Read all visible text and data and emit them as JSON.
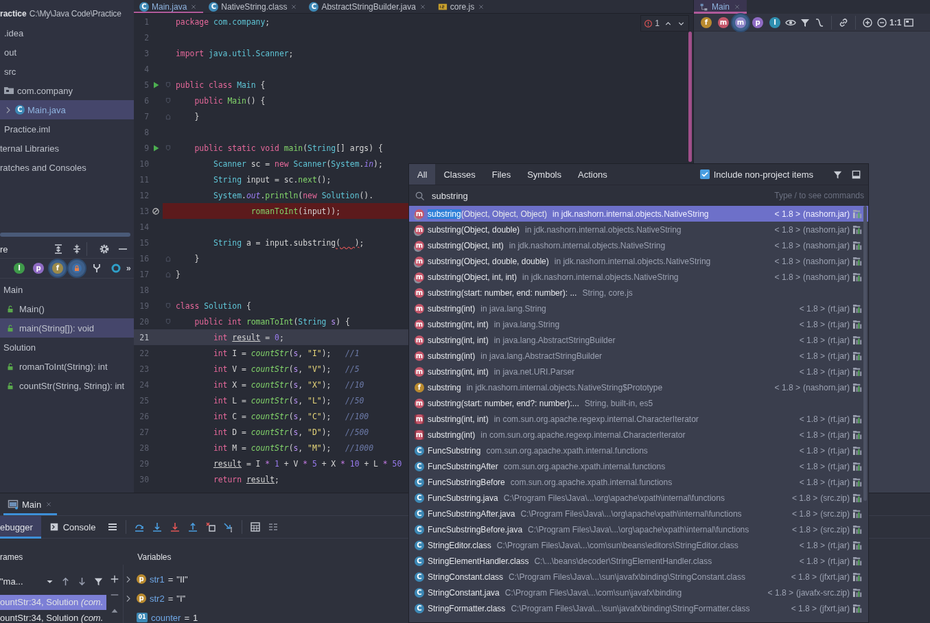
{
  "editor_tabs": [
    {
      "label": "Main.java",
      "kind": "class",
      "badge": "C",
      "selected": true
    },
    {
      "label": "NativeString.class",
      "kind": "class",
      "badge": "C",
      "selected": false
    },
    {
      "label": "AbstractStringBuilder.java",
      "kind": "class",
      "badge": "C",
      "selected": false
    },
    {
      "label": "core.js",
      "kind": "js",
      "selected": false
    }
  ],
  "project": {
    "items": [
      {
        "label": "ractice",
        "path": "C:\\My\\Java Code\\Practice",
        "selected": false,
        "children": [
          {
            "label": ".idea",
            "selected": false
          },
          {
            "label": "out",
            "selected": false
          },
          {
            "label": "src",
            "selected": false,
            "children": [
              {
                "label": "com.company",
                "kind": "package",
                "selected": false,
                "children": [
                  {
                    "label": "Main.java",
                    "kind": "class",
                    "badge": "C",
                    "selected": true,
                    "expanded": false
                  }
                ]
              }
            ]
          },
          {
            "label": "Practice.iml",
            "selected": false
          }
        ]
      },
      {
        "label": "ternal Libraries",
        "selected": false
      },
      {
        "label": "ratches and Consoles",
        "selected": false
      }
    ]
  },
  "structure": {
    "title": "re",
    "tools": [
      {
        "kind": "expand-all"
      },
      {
        "kind": "collapse-all"
      },
      {
        "kind": "separator"
      },
      {
        "kind": "gear"
      },
      {
        "kind": "minimize"
      }
    ],
    "toolbar": [
      {
        "kind": "badge",
        "badge": "I",
        "color": "#3f9b4a",
        "selected": false
      },
      {
        "kind": "badge",
        "badge": "p",
        "color": "#8f6bc4",
        "selected": false
      },
      {
        "kind": "badge",
        "badge": "f",
        "color": "#9c8a4a",
        "selected": true
      },
      {
        "kind": "lock",
        "selected": true
      },
      {
        "kind": "fork"
      },
      {
        "kind": "ring"
      },
      {
        "kind": "text",
        "label": "»"
      }
    ],
    "items": [
      {
        "label": "Main",
        "selected": false,
        "children": [
          {
            "label": "Main()",
            "kind": "method",
            "selected": false
          },
          {
            "label": "main(String[]): void",
            "kind": "method",
            "selected": true
          }
        ]
      },
      {
        "label": "Solution",
        "selected": false,
        "children": [
          {
            "label": "romanToInt(String): int",
            "kind": "method",
            "selected": false
          },
          {
            "label": "countStr(String, String): int",
            "kind": "method",
            "selected": false
          }
        ]
      }
    ]
  },
  "editor": {
    "problems": {
      "count": "1"
    },
    "lines": [
      {
        "n": "1",
        "tokens": [
          {
            "kind": "kw",
            "text": "package "
          },
          {
            "kind": "type",
            "text": "com.company"
          },
          {
            "kind": "pl",
            "text": ";"
          }
        ]
      },
      {
        "n": "2"
      },
      {
        "n": "3",
        "tokens": [
          {
            "kind": "kw",
            "text": "import "
          },
          {
            "kind": "type",
            "text": "java.util.Scanner"
          },
          {
            "kind": "pl",
            "text": ";"
          }
        ]
      },
      {
        "n": "4"
      },
      {
        "n": "5",
        "gutter": {
          "kind": "run"
        },
        "fold": {
          "kind": "start"
        },
        "tokens": [
          {
            "kind": "kw",
            "text": "public class "
          },
          {
            "kind": "type",
            "text": "Main"
          },
          {
            "kind": "pl",
            "text": " {"
          }
        ]
      },
      {
        "n": "6",
        "fold": {
          "kind": "start"
        },
        "tokens": [
          {
            "kind": "kw",
            "text": "    public "
          },
          {
            "kind": "fn",
            "text": "Main"
          },
          {
            "kind": "pl",
            "text": "() {"
          }
        ]
      },
      {
        "n": "7",
        "fold": {
          "kind": "end"
        },
        "tokens": [
          {
            "kind": "pl",
            "text": "    }"
          }
        ]
      },
      {
        "n": "8"
      },
      {
        "n": "9",
        "gutter": {
          "kind": "run"
        },
        "fold": {
          "kind": "start"
        },
        "tokens": [
          {
            "kind": "kw",
            "text": "    public static void "
          },
          {
            "kind": "fn",
            "text": "main"
          },
          {
            "kind": "pl",
            "text": "("
          },
          {
            "kind": "type",
            "text": "String"
          },
          {
            "kind": "pl",
            "text": "[] args) {"
          }
        ]
      },
      {
        "n": "10",
        "tokens": [
          {
            "kind": "type",
            "text": "        Scanner"
          },
          {
            "kind": "pl",
            "text": " sc = "
          },
          {
            "kind": "kw",
            "text": "new "
          },
          {
            "kind": "type",
            "text": "Scanner"
          },
          {
            "kind": "pl",
            "text": "("
          },
          {
            "kind": "type",
            "text": "System"
          },
          {
            "kind": "pl",
            "text": "."
          },
          {
            "kind": "fld",
            "text": "in"
          },
          {
            "kind": "pl",
            "text": ");"
          }
        ]
      },
      {
        "n": "11",
        "tokens": [
          {
            "kind": "type",
            "text": "        String"
          },
          {
            "kind": "pl",
            "text": " input = sc."
          },
          {
            "kind": "fn",
            "text": "next"
          },
          {
            "kind": "pl",
            "text": "();"
          }
        ]
      },
      {
        "n": "12",
        "tokens": [
          {
            "kind": "type",
            "text": "        System"
          },
          {
            "kind": "pl",
            "text": "."
          },
          {
            "kind": "fld",
            "text": "out"
          },
          {
            "kind": "pl",
            "text": "."
          },
          {
            "kind": "fn",
            "text": "println"
          },
          {
            "kind": "pl",
            "text": "("
          },
          {
            "kind": "kw",
            "text": "new "
          },
          {
            "kind": "type",
            "text": "Solution"
          },
          {
            "kind": "pl",
            "text": "()."
          }
        ]
      },
      {
        "n": "13",
        "gutter": {
          "kind": "muted-breakpoint"
        },
        "highlight": {
          "kind": "breakpoint"
        },
        "tokens": [
          {
            "kind": "fn",
            "text": "                romanToInt"
          },
          {
            "kind": "pl",
            "text": "(input));"
          }
        ]
      },
      {
        "n": "14"
      },
      {
        "n": "15",
        "tokens": [
          {
            "kind": "type",
            "text": "        String"
          },
          {
            "kind": "pl",
            "text": " a = input.substring"
          },
          {
            "kind": "err",
            "text": "(   )"
          },
          {
            "kind": "pl",
            "text": ";"
          }
        ]
      },
      {
        "n": "16",
        "fold": {
          "kind": "end"
        },
        "tokens": [
          {
            "kind": "pl",
            "text": "    }"
          }
        ]
      },
      {
        "n": "17",
        "fold": {
          "kind": "end"
        },
        "tokens": [
          {
            "kind": "pl",
            "text": "}"
          }
        ]
      },
      {
        "n": "18"
      },
      {
        "n": "19",
        "fold": {
          "kind": "start"
        },
        "tokens": [
          {
            "kind": "kw",
            "text": "class "
          },
          {
            "kind": "type",
            "text": "Solution"
          },
          {
            "kind": "pl",
            "text": " {"
          }
        ]
      },
      {
        "n": "20",
        "fold": {
          "kind": "start"
        },
        "tokens": [
          {
            "kind": "kw",
            "text": "    public int "
          },
          {
            "kind": "fn",
            "text": "romanToInt"
          },
          {
            "kind": "pl",
            "text": "("
          },
          {
            "kind": "type",
            "text": "String "
          },
          {
            "kind": "par",
            "text": "s"
          },
          {
            "kind": "pl",
            "text": ") {"
          }
        ]
      },
      {
        "n": "21",
        "highlight": {
          "kind": "current"
        },
        "tokens": [
          {
            "kind": "kw",
            "text": "        int "
          },
          {
            "kind": "var",
            "text": "result"
          },
          {
            "kind": "pl",
            "text": " = "
          },
          {
            "kind": "num",
            "text": "0"
          },
          {
            "kind": "pl",
            "text": ";"
          }
        ]
      },
      {
        "n": "22",
        "tokens": [
          {
            "kind": "kw",
            "text": "        int "
          },
          {
            "kind": "pl",
            "text": "I = "
          },
          {
            "kind": "fni",
            "text": "countStr"
          },
          {
            "kind": "pl",
            "text": "("
          },
          {
            "kind": "par",
            "text": "s"
          },
          {
            "kind": "pl",
            "text": ", "
          },
          {
            "kind": "str",
            "text": "\"I\""
          },
          {
            "kind": "pl",
            "text": ");   "
          },
          {
            "kind": "cm",
            "text": "//1"
          }
        ]
      },
      {
        "n": "23",
        "tokens": [
          {
            "kind": "kw",
            "text": "        int "
          },
          {
            "kind": "pl",
            "text": "V = "
          },
          {
            "kind": "fni",
            "text": "countStr"
          },
          {
            "kind": "pl",
            "text": "("
          },
          {
            "kind": "par",
            "text": "s"
          },
          {
            "kind": "pl",
            "text": ", "
          },
          {
            "kind": "str",
            "text": "\"V\""
          },
          {
            "kind": "pl",
            "text": ");   "
          },
          {
            "kind": "cm",
            "text": "//5"
          }
        ]
      },
      {
        "n": "24",
        "tokens": [
          {
            "kind": "kw",
            "text": "        int "
          },
          {
            "kind": "pl",
            "text": "X = "
          },
          {
            "kind": "fni",
            "text": "countStr"
          },
          {
            "kind": "pl",
            "text": "("
          },
          {
            "kind": "par",
            "text": "s"
          },
          {
            "kind": "pl",
            "text": ", "
          },
          {
            "kind": "str",
            "text": "\"X\""
          },
          {
            "kind": "pl",
            "text": ");   "
          },
          {
            "kind": "cm",
            "text": "//10"
          }
        ]
      },
      {
        "n": "25",
        "tokens": [
          {
            "kind": "kw",
            "text": "        int "
          },
          {
            "kind": "pl",
            "text": "L = "
          },
          {
            "kind": "fni",
            "text": "countStr"
          },
          {
            "kind": "pl",
            "text": "("
          },
          {
            "kind": "par",
            "text": "s"
          },
          {
            "kind": "pl",
            "text": ", "
          },
          {
            "kind": "str",
            "text": "\"L\""
          },
          {
            "kind": "pl",
            "text": ");   "
          },
          {
            "kind": "cm",
            "text": "//50"
          }
        ]
      },
      {
        "n": "26",
        "tokens": [
          {
            "kind": "kw",
            "text": "        int "
          },
          {
            "kind": "pl",
            "text": "C = "
          },
          {
            "kind": "fni",
            "text": "countStr"
          },
          {
            "kind": "pl",
            "text": "("
          },
          {
            "kind": "par",
            "text": "s"
          },
          {
            "kind": "pl",
            "text": ", "
          },
          {
            "kind": "str",
            "text": "\"C\""
          },
          {
            "kind": "pl",
            "text": ");   "
          },
          {
            "kind": "cm",
            "text": "//100"
          }
        ]
      },
      {
        "n": "27",
        "tokens": [
          {
            "kind": "kw",
            "text": "        int "
          },
          {
            "kind": "pl",
            "text": "D = "
          },
          {
            "kind": "fni",
            "text": "countStr"
          },
          {
            "kind": "pl",
            "text": "("
          },
          {
            "kind": "par",
            "text": "s"
          },
          {
            "kind": "pl",
            "text": ", "
          },
          {
            "kind": "str",
            "text": "\"D\""
          },
          {
            "kind": "pl",
            "text": ");   "
          },
          {
            "kind": "cm",
            "text": "//500"
          }
        ]
      },
      {
        "n": "28",
        "tokens": [
          {
            "kind": "kw",
            "text": "        int "
          },
          {
            "kind": "pl",
            "text": "M = "
          },
          {
            "kind": "fni",
            "text": "countStr"
          },
          {
            "kind": "pl",
            "text": "("
          },
          {
            "kind": "par",
            "text": "s"
          },
          {
            "kind": "pl",
            "text": ", "
          },
          {
            "kind": "str",
            "text": "\"M\""
          },
          {
            "kind": "pl",
            "text": ");   "
          },
          {
            "kind": "cm",
            "text": "//1000"
          }
        ]
      },
      {
        "n": "29",
        "tokens": [
          {
            "kind": "var",
            "text": "        result"
          },
          {
            "kind": "pl",
            "text": " = I "
          },
          {
            "kind": "op",
            "text": "* "
          },
          {
            "kind": "num",
            "text": "1"
          },
          {
            "kind": "pl",
            "text": " + V "
          },
          {
            "kind": "op",
            "text": "* "
          },
          {
            "kind": "num",
            "text": "5"
          },
          {
            "kind": "pl",
            "text": " + X "
          },
          {
            "kind": "op",
            "text": "* "
          },
          {
            "kind": "num",
            "text": "10"
          },
          {
            "kind": "pl",
            "text": " + L "
          },
          {
            "kind": "op",
            "text": "* "
          },
          {
            "kind": "num",
            "text": "50"
          }
        ]
      },
      {
        "n": "30",
        "tokens": [
          {
            "kind": "kw",
            "text": "        return "
          },
          {
            "kind": "var",
            "text": "result"
          },
          {
            "kind": "pl",
            "text": ";"
          }
        ]
      }
    ]
  },
  "diagram": {
    "tab": {
      "label": "Main",
      "selected": true
    },
    "toolbar": [
      {
        "kind": "badge",
        "badge": "f",
        "color": "#b98a2f",
        "selected": false
      },
      {
        "kind": "badge",
        "badge": "m",
        "color": "#c4566a",
        "selected": false
      },
      {
        "kind": "badge",
        "badge": "m",
        "color": "#8f86c8",
        "selected": true
      },
      {
        "kind": "badge",
        "badge": "p",
        "color": "#8f6bc4",
        "selected": false
      },
      {
        "kind": "badge",
        "badge": "I",
        "color": "#2f8fb0",
        "selected": false
      },
      {
        "kind": "eye"
      },
      {
        "kind": "filter"
      },
      {
        "kind": "route"
      },
      {
        "kind": "separator"
      },
      {
        "kind": "link"
      },
      {
        "kind": "separator"
      },
      {
        "kind": "zoom-in"
      },
      {
        "kind": "zoom-out"
      },
      {
        "kind": "text",
        "label": "1:1"
      },
      {
        "kind": "fit"
      }
    ]
  },
  "debug": {
    "tabs": [
      {
        "label": "Main",
        "selected": true
      }
    ],
    "toolbar": [
      {
        "kind": "tab",
        "label": "ebugger",
        "selected": true
      },
      {
        "kind": "console-tab",
        "label": "Console",
        "selected": false
      },
      {
        "kind": "menu"
      },
      {
        "kind": "separator"
      },
      {
        "kind": "step-over"
      },
      {
        "kind": "step-into"
      },
      {
        "kind": "force-step-into"
      },
      {
        "kind": "step-out"
      },
      {
        "kind": "drop-frame"
      },
      {
        "kind": "run-to-cursor"
      },
      {
        "kind": "separator"
      },
      {
        "kind": "calculator"
      },
      {
        "kind": "trace"
      }
    ],
    "frames_label": "rames",
    "variables_label": "Variables",
    "thread": "\"ma...",
    "frames": [
      {
        "text": "ountStr:34, Solution *(com.*",
        "selected": true
      },
      {
        "text": "ountStr:34, Solution *(com.*",
        "selected": false
      }
    ],
    "variables": [
      {
        "name": "str1",
        "operator": "=",
        "value": "\"II\"",
        "kind": "param",
        "badge": "p",
        "expandable": true
      },
      {
        "name": "str2",
        "operator": "=",
        "value": "\"I\"",
        "kind": "param",
        "badge": "p",
        "expandable": true
      },
      {
        "name": "counter",
        "operator": "=",
        "value": "1",
        "kind": "local",
        "badge": "01",
        "expandable": false
      }
    ]
  },
  "search_popup": {
    "tabs": [
      {
        "label": "All",
        "selected": true
      },
      {
        "label": "Classes",
        "selected": false
      },
      {
        "label": "Files",
        "selected": false
      },
      {
        "label": "Symbols",
        "selected": false
      },
      {
        "label": "Actions",
        "selected": false
      }
    ],
    "include_non_project": {
      "label": "Include non-project items",
      "checked": true
    },
    "query": "substring",
    "hint": "Type / to see commands",
    "results": [
      {
        "kind": "method-static",
        "badge": "m",
        "name": "substring(Object, Object, Object)",
        "detail": "in jdk.nashorn.internal.objects.NativeString",
        "version": "< 1.8 >",
        "source": "(nashorn.jar)",
        "selected": true
      },
      {
        "kind": "method-static",
        "badge": "m",
        "name": "substring(Object, double)",
        "detail": "in jdk.nashorn.internal.objects.NativeString",
        "version": "< 1.8 >",
        "source": "(nashorn.jar)",
        "selected": false
      },
      {
        "kind": "method-static",
        "badge": "m",
        "name": "substring(Object, int)",
        "detail": "in jdk.nashorn.internal.objects.NativeString",
        "version": "< 1.8 >",
        "source": "(nashorn.jar)",
        "selected": false
      },
      {
        "kind": "method-static",
        "badge": "m",
        "name": "substring(Object, double, double)",
        "detail": "in jdk.nashorn.internal.objects.NativeString",
        "version": "< 1.8 >",
        "source": "(nashorn.jar)",
        "selected": false
      },
      {
        "kind": "method-static",
        "badge": "m",
        "name": "substring(Object, int, int)",
        "detail": "in jdk.nashorn.internal.objects.NativeString",
        "version": "< 1.8 >",
        "source": "(nashorn.jar)",
        "selected": false
      },
      {
        "kind": "method",
        "badge": "m",
        "name": "substring(start: number, end: number): ...",
        "detail": "String, core.js",
        "selected": false
      },
      {
        "kind": "method",
        "badge": "m",
        "name": "substring(int)",
        "detail": "in java.lang.String",
        "version": "< 1.8 >",
        "source": "(rt.jar)",
        "selected": false
      },
      {
        "kind": "method",
        "badge": "m",
        "name": "substring(int, int)",
        "detail": "in java.lang.String",
        "version": "< 1.8 >",
        "source": "(rt.jar)",
        "selected": false
      },
      {
        "kind": "method",
        "badge": "m",
        "name": "substring(int, int)",
        "detail": "in java.lang.AbstractStringBuilder",
        "version": "< 1.8 >",
        "source": "(rt.jar)",
        "selected": false
      },
      {
        "kind": "method",
        "badge": "m",
        "name": "substring(int)",
        "detail": "in java.lang.AbstractStringBuilder",
        "version": "< 1.8 >",
        "source": "(rt.jar)",
        "selected": false
      },
      {
        "kind": "method",
        "badge": "m",
        "name": "substring(int, int)",
        "detail": "in java.net.URI.Parser",
        "version": "< 1.8 >",
        "source": "(rt.jar)",
        "selected": false
      },
      {
        "kind": "field",
        "badge": "f",
        "name": "substring",
        "detail": "in jdk.nashorn.internal.objects.NativeString$Prototype",
        "version": "< 1.8 >",
        "source": "(nashorn.jar)",
        "selected": false
      },
      {
        "kind": "method",
        "badge": "m",
        "name": "substring(start: number, end?: number):...",
        "detail": "String, built-in, es5",
        "selected": false
      },
      {
        "kind": "method-bracket",
        "badge": "m",
        "name": "substring(int, int)",
        "detail": "in com.sun.org.apache.regexp.internal.CharacterIterator",
        "version": "< 1.8 >",
        "source": "(rt.jar)",
        "selected": false
      },
      {
        "kind": "method-bracket",
        "badge": "m",
        "name": "substring(int)",
        "detail": "in com.sun.org.apache.regexp.internal.CharacterIterator",
        "version": "< 1.8 >",
        "source": "(rt.jar)",
        "selected": false
      },
      {
        "kind": "class",
        "badge": "C",
        "name": "FuncSubstring",
        "detail": "com.sun.org.apache.xpath.internal.functions",
        "version": "< 1.8 >",
        "source": "(rt.jar)",
        "selected": false
      },
      {
        "kind": "class",
        "badge": "C",
        "name": "FuncSubstringAfter",
        "detail": "com.sun.org.apache.xpath.internal.functions",
        "version": "< 1.8 >",
        "source": "(rt.jar)",
        "selected": false
      },
      {
        "kind": "class",
        "badge": "C",
        "name": "FuncSubstringBefore",
        "detail": "com.sun.org.apache.xpath.internal.functions",
        "version": "< 1.8 >",
        "source": "(rt.jar)",
        "selected": false
      },
      {
        "kind": "class",
        "badge": "C",
        "name": "FuncSubstring.java",
        "detail": "C:\\Program Files\\Java\\...\\org\\apache\\xpath\\internal\\functions",
        "version": "< 1.8 >",
        "source": "(src.zip)",
        "selected": false
      },
      {
        "kind": "class",
        "badge": "C",
        "name": "FuncSubstringAfter.java",
        "detail": "C:\\Program Files\\Java\\...\\org\\apache\\xpath\\internal\\functions",
        "version": "< 1.8 >",
        "source": "(src.zip)",
        "selected": false
      },
      {
        "kind": "class",
        "badge": "C",
        "name": "FuncSubstringBefore.java",
        "detail": "C:\\Program Files\\Java\\...\\org\\apache\\xpath\\internal\\functions",
        "version": "< 1.8 >",
        "source": "(src.zip)",
        "selected": false
      },
      {
        "kind": "class",
        "badge": "C",
        "name": "StringEditor.class",
        "detail": "C:\\Program Files\\Java\\...\\com\\sun\\beans\\editors\\StringEditor.class",
        "version": "< 1.8 >",
        "source": "(rt.jar)",
        "selected": false
      },
      {
        "kind": "class",
        "badge": "C",
        "name": "StringElementHandler.class",
        "detail": "C:\\...\\beans\\decoder\\StringElementHandler.class",
        "version": "< 1.8 >",
        "source": "(rt.jar)",
        "selected": false
      },
      {
        "kind": "class",
        "badge": "C",
        "name": "StringConstant.class",
        "detail": "C:\\Program Files\\Java\\...\\sun\\javafx\\binding\\StringConstant.class",
        "version": "< 1.8 >",
        "source": "(jfxrt.jar)",
        "selected": false
      },
      {
        "kind": "class",
        "badge": "C",
        "name": "StringConstant.java",
        "detail": "C:\\Program Files\\Java\\...\\com\\sun\\javafx\\binding",
        "version": "< 1.8 >",
        "source": "(javafx-src.zip)",
        "selected": false
      },
      {
        "kind": "class",
        "badge": "C",
        "name": "StringFormatter.class",
        "detail": "C:\\Program Files\\Java\\...\\sun\\javafx\\binding\\StringFormatter.class",
        "version": "< 1.8 >",
        "source": "(jfxrt.jar)",
        "selected": false
      }
    ]
  }
}
